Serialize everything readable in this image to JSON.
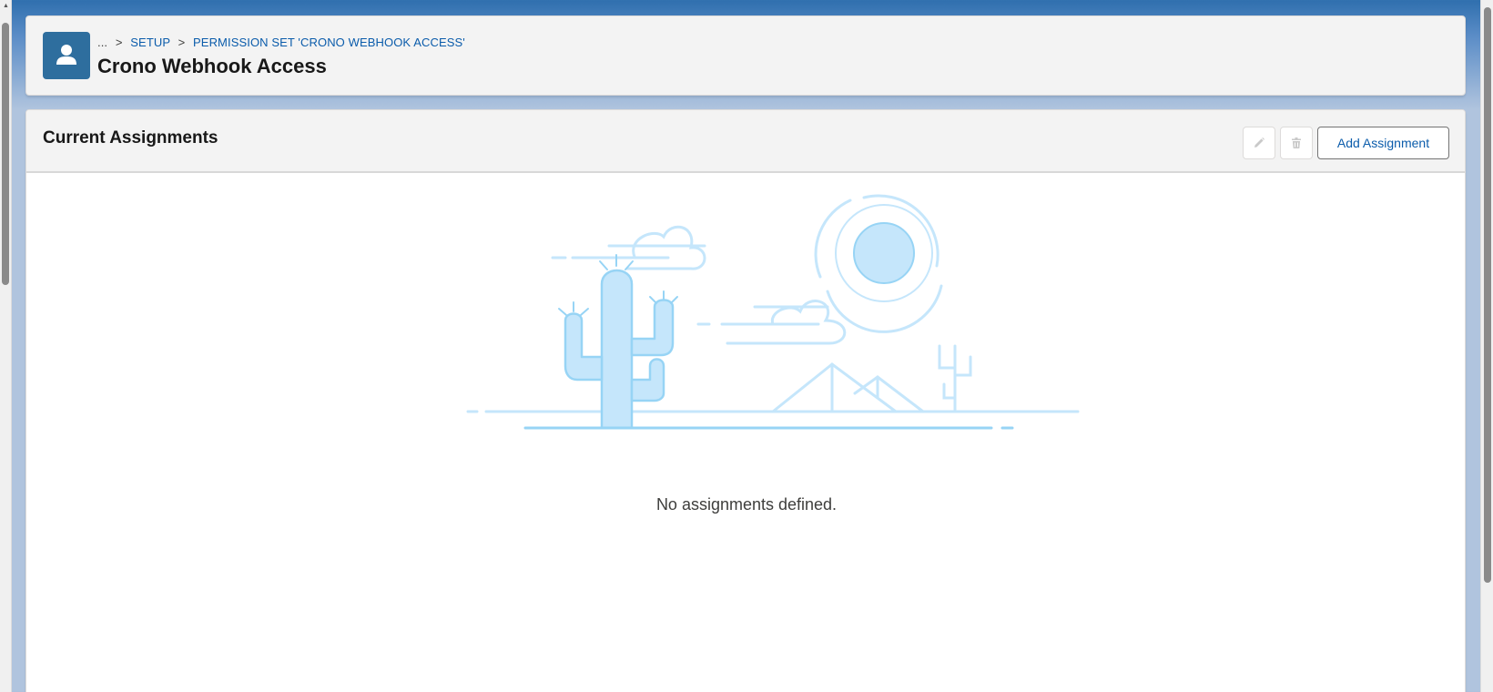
{
  "header": {
    "breadcrumb": {
      "ellipsis": "...",
      "separator": ">",
      "items": [
        {
          "label": "SETUP"
        },
        {
          "label": "PERMISSION SET 'CRONO WEBHOOK ACCESS'"
        }
      ]
    },
    "title": "Crono Webhook Access",
    "icon": "user-icon"
  },
  "assignments": {
    "title": "Current Assignments",
    "actions": {
      "edit_icon": "pencil-icon",
      "delete_icon": "trash-icon",
      "add_label": "Add Assignment"
    },
    "empty_message": "No assignments defined.",
    "illustration": "desert-empty-state-illustration"
  },
  "colors": {
    "brand_blue": "#0b5cab",
    "icon_bg": "#2e6e9e",
    "illustration_light": "#c5e6fb",
    "illustration_stroke": "#97d4f5"
  }
}
